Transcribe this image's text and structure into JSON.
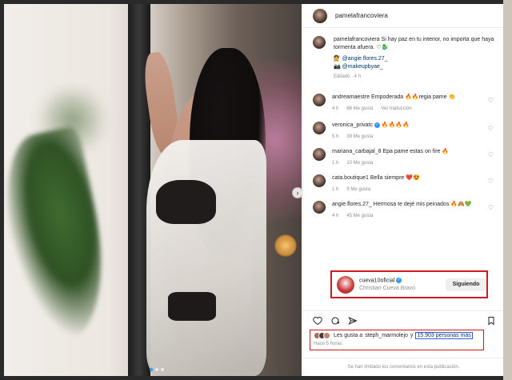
{
  "post": {
    "author": "pamelafrancoviera",
    "caption_user": "pamelafrancoviera",
    "caption_text": "Si hay paz en tu interior, no importa que haya tormenta afuera. ♡🐉",
    "caption_mention_1": "@angie.flores.27_",
    "caption_mention_2": "@makeupbyae_",
    "caption_meta": "Editado · 4 h"
  },
  "comments": [
    {
      "user": "andreamaestre",
      "text": "Empoderada 🔥🔥regia pame 👏",
      "time": "4 h",
      "likes": "68 Me gusta",
      "reply": "Ver traducción"
    },
    {
      "user": "veronica_privatc",
      "text": "🔥🔥🔥🔥",
      "time": "5 h",
      "likes": "39 Me gusta"
    },
    {
      "user": "mariana_carbajal_8",
      "text": "Epa pame estas on fire 🔥",
      "time": "1 h",
      "likes": "10 Me gusta"
    },
    {
      "user": "cata.boutique1",
      "text": "Bella siempre ❤️😍",
      "time": "1 h",
      "likes": "9 Me gusta"
    },
    {
      "user": "angie.flores.27_",
      "text": "Hermosa te dejé mis peinados 🔥🙈💚",
      "time": "4 h",
      "likes": "45 Me gusta"
    }
  ],
  "follow_card": {
    "username": "cueva10oficial",
    "full_name": "Christian Cueva Bravo",
    "button": "Siguiendo"
  },
  "likes": {
    "prefix": "Les gusta a",
    "user": "steph_marmolejo",
    "conj": "y",
    "count": "15.903 personas más",
    "time": "Hace 5 horas"
  },
  "footer": "Se han limitado los comentarios en esta publicación.",
  "carousel": {
    "next": "›"
  },
  "colors": {
    "highlight": "#d0191f",
    "link": "#00376b",
    "verified": "#3897f0"
  }
}
